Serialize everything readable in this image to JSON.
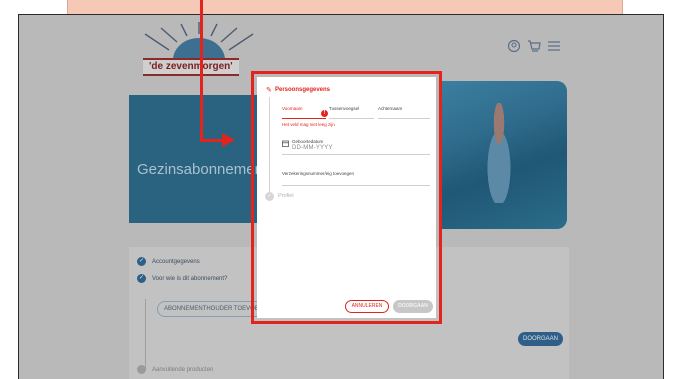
{
  "colors": {
    "accent": "#e2241c",
    "brand_blue": "#2f5f86",
    "overlay": "#b9b9b9"
  },
  "header": {
    "logo_text": "'de zevenmorgen'",
    "icons": [
      "account-icon",
      "cart-icon",
      "menu-icon"
    ]
  },
  "hero": {
    "title": "Gezinsabonnement"
  },
  "steps": {
    "items": [
      {
        "label": "Accountgegevens",
        "state": "done"
      },
      {
        "label": "Voor wie is dit abonnement?",
        "state": "active"
      },
      {
        "label": "Aanvullende producten",
        "state": "pending"
      }
    ],
    "add_holder_button": "ABONNEMENTHOUDER TOEVOEGEN",
    "continue_button": "DOORGAAN"
  },
  "modal": {
    "section_title": "Persoonsgegevens",
    "fields": {
      "first_name_label": "Voornaam",
      "infix_label": "Tussenvoegsel",
      "last_name_label": "Achternaam",
      "first_name_error": "Het veld mag niet leeg zijn",
      "dob_label": "Geboortedatum",
      "dob_placeholder": "DD-MM-YYYY",
      "insurance_label": "Verzekeringsnummer/eig toevoegen"
    },
    "next_section": "Profiel",
    "cancel_button": "ANNULEREN",
    "continue_button": "DOORGAAN"
  }
}
